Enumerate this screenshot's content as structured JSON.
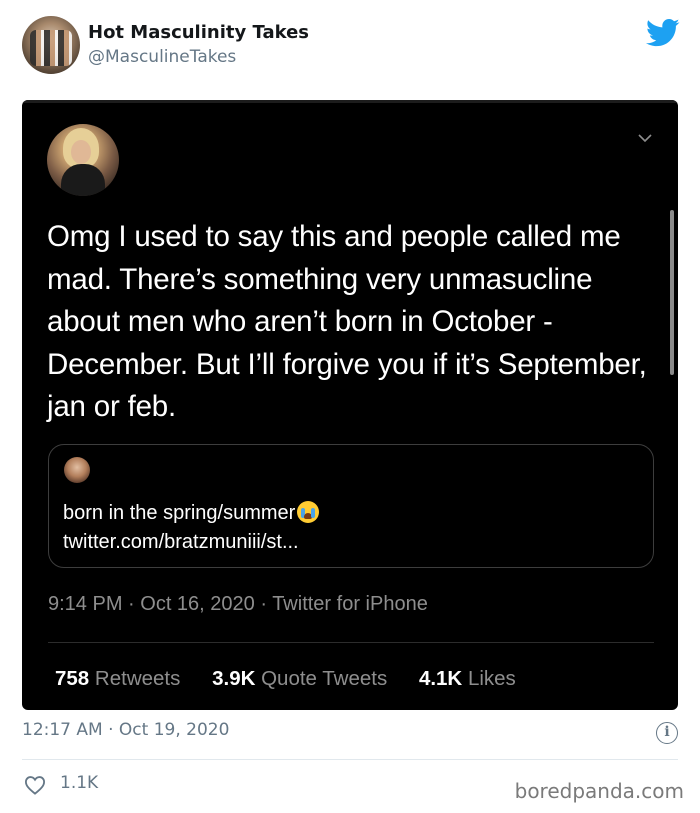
{
  "account": {
    "name": "Hot Masculinity Takes",
    "handle": "@MasculineTakes"
  },
  "screenshot": {
    "text": "Omg I used to say this and people called me mad. There’s something very unmasucline about men who aren’t born in October - December. But I’ll forgive you if it’s September, jan or feb.",
    "quote": {
      "text": "born in the spring/summer",
      "emoji": "loudly-crying-face",
      "link": "twitter.com/bratzmuniii/st..."
    },
    "meta": "9:14 PM · Oct 16, 2020 · Twitter for iPhone",
    "retweets_count": "758",
    "retweets_label": "Retweets",
    "quotes_count": "3.9K",
    "quotes_label": "Quote Tweets",
    "likes_count": "4.1K",
    "likes_label": "Likes"
  },
  "footer": {
    "timestamp": "12:17 AM · Oct 19, 2020",
    "likes": "1.1K",
    "watermark": "boredpanda.com"
  },
  "colors": {
    "twitter_blue": "#1da1f2",
    "secondary_text": "#657786",
    "dark_bg": "#000000"
  },
  "icons": [
    "twitter-bird-icon",
    "chevron-down-icon",
    "info-icon",
    "heart-icon"
  ]
}
